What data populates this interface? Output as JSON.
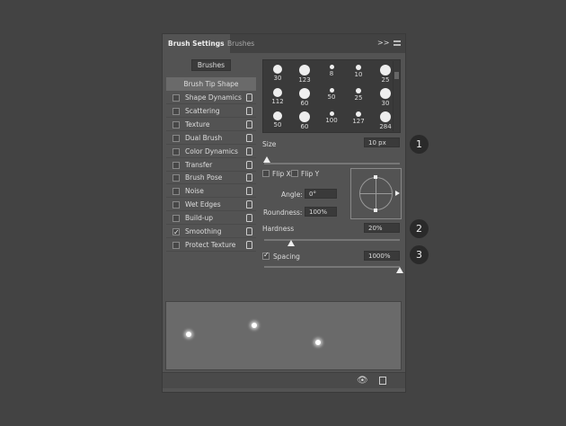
{
  "tabs": [
    {
      "label": "Brush Settings",
      "active": true
    },
    {
      "label": "Brushes",
      "active": false
    }
  ],
  "header_icons": [
    "expand-icon",
    "menu-icon"
  ],
  "brushes_button": "Brushes",
  "tip_shape_label": "Brush Tip Shape",
  "options": [
    {
      "label": "Shape Dynamics",
      "checked": false
    },
    {
      "label": "Scattering",
      "checked": false
    },
    {
      "label": "Texture",
      "checked": false
    },
    {
      "label": "Dual Brush",
      "checked": false
    },
    {
      "label": "Color Dynamics",
      "checked": false
    },
    {
      "label": "Transfer",
      "checked": false
    },
    {
      "label": "Brush Pose",
      "checked": false
    },
    {
      "label": "Noise",
      "checked": false
    },
    {
      "label": "Wet Edges",
      "checked": false
    },
    {
      "label": "Build-up",
      "checked": false
    },
    {
      "label": "Smoothing",
      "checked": true
    },
    {
      "label": "Protect Texture",
      "checked": false
    }
  ],
  "brush_sizes": [
    "30",
    "123",
    "8",
    "10",
    "25",
    "112",
    "60",
    "50",
    "25",
    "30",
    "50",
    "60",
    "100",
    "127",
    "284",
    "",
    "",
    "",
    "",
    ""
  ],
  "size": {
    "label": "Size",
    "value": "10 px",
    "slider": 0.02
  },
  "flip_x": {
    "label": "Flip X",
    "checked": false
  },
  "flip_y": {
    "label": "Flip Y",
    "checked": false
  },
  "angle": {
    "label": "Angle:",
    "value": "0°"
  },
  "roundness": {
    "label": "Roundness:",
    "value": "100%"
  },
  "hardness": {
    "label": "Hardness",
    "value": "20%",
    "slider": 0.2
  },
  "spacing": {
    "label": "Spacing",
    "value": "1000%",
    "checked": true,
    "slider": 1.0
  },
  "callouts": [
    "1",
    "2",
    "3"
  ]
}
